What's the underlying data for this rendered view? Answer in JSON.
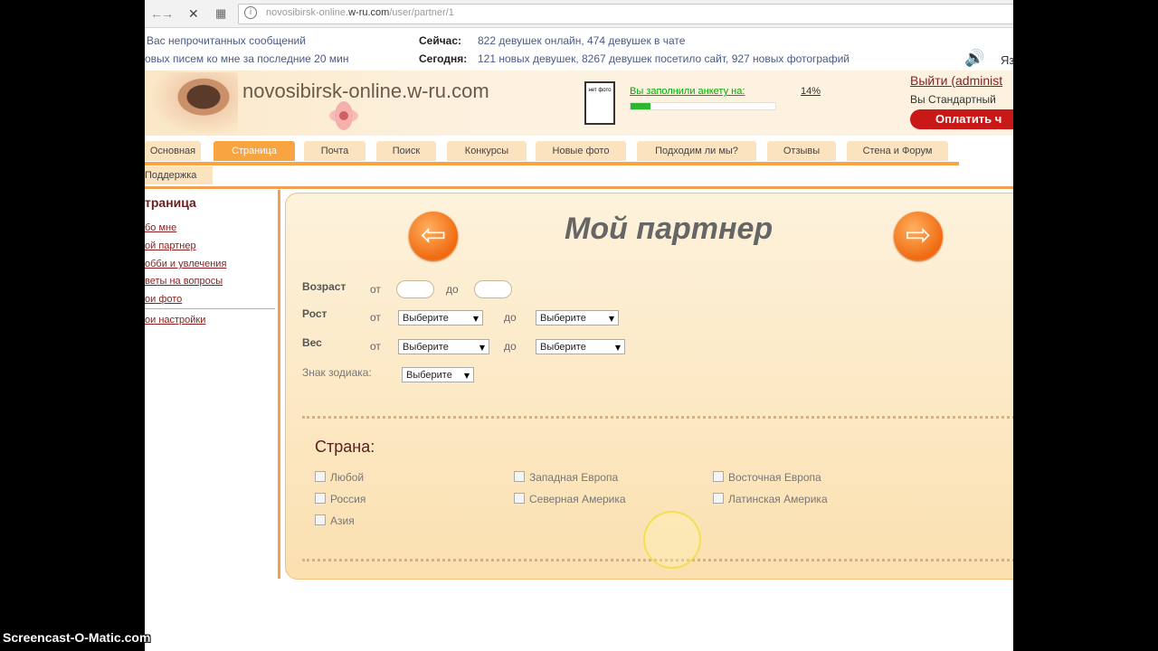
{
  "browser": {
    "url_host": "novosibirsk-online.",
    "url_domain": "w-ru.com",
    "url_path": "/user/partner/1"
  },
  "topinfo": {
    "unread_messages": "Вас непрочитанных сообщений",
    "new_letters": "овых писем ко мне за последние 20 мин",
    "now_label": "Сейчас:",
    "now_text": "822 девушек онлайн, 474 девушек в чате",
    "today_label": "Сегодня:",
    "today_text": "121 новых девушек, 8267 девушек посетило сайт, 927 новых фотографий",
    "side_letter": "Яз"
  },
  "header": {
    "site_name": "novosibirsk-online.w-ru.com",
    "no_photo": "нет фото",
    "profile_fill_label": "Вы заполнили анкету на:",
    "profile_fill_pct": "14%",
    "profile_fill_value": 0.14,
    "logout": "Выйти (administ",
    "account_status": "Вы Стандартный",
    "pay_button": "Оплатить ч"
  },
  "menu": {
    "tabs": [
      "Основная",
      "Страница",
      "Почта",
      "Поиск",
      "Конкурсы",
      "Новые фото",
      "Подходим ли мы?",
      "Отзывы",
      "Стена и Форум"
    ],
    "active_index": 1,
    "support": "Поддержка"
  },
  "sidebar": {
    "title": "траница",
    "links": [
      "бо мне",
      "ой партнер",
      "обби и увлечения",
      "веты на вопросы",
      "ои фото"
    ],
    "settings": "ои настройки"
  },
  "main": {
    "title": "Мой партнер",
    "age_label": "Возраст",
    "height_label": "Рост",
    "weight_label": "Вес",
    "zodiac_label": "Знак зодиака:",
    "from": "от",
    "to": "до",
    "select_placeholder": "Выберите",
    "country_title": "Страна:",
    "countries": [
      "Любой",
      "Западная Европа",
      "Восточная Европа",
      "Россия",
      "Северная Америка",
      "Латинская Америка",
      "Азия"
    ]
  },
  "watermark": "Screencast-O-Matic.com",
  "colors": {
    "accent": "#f7a441",
    "brand_dark_red": "#8a2020",
    "pay_red": "#c81818",
    "progress_green": "#2fb52f"
  },
  "icons": {
    "back": "back-arrow-icon",
    "forward": "forward-arrow-icon",
    "reload": "stop-icon",
    "apps": "apps-icon",
    "info": "info-icon",
    "speaker": "speaker-icon",
    "prev": "prev-arrow-icon",
    "next": "next-arrow-icon",
    "cursor": "cursor-highlight-icon"
  }
}
